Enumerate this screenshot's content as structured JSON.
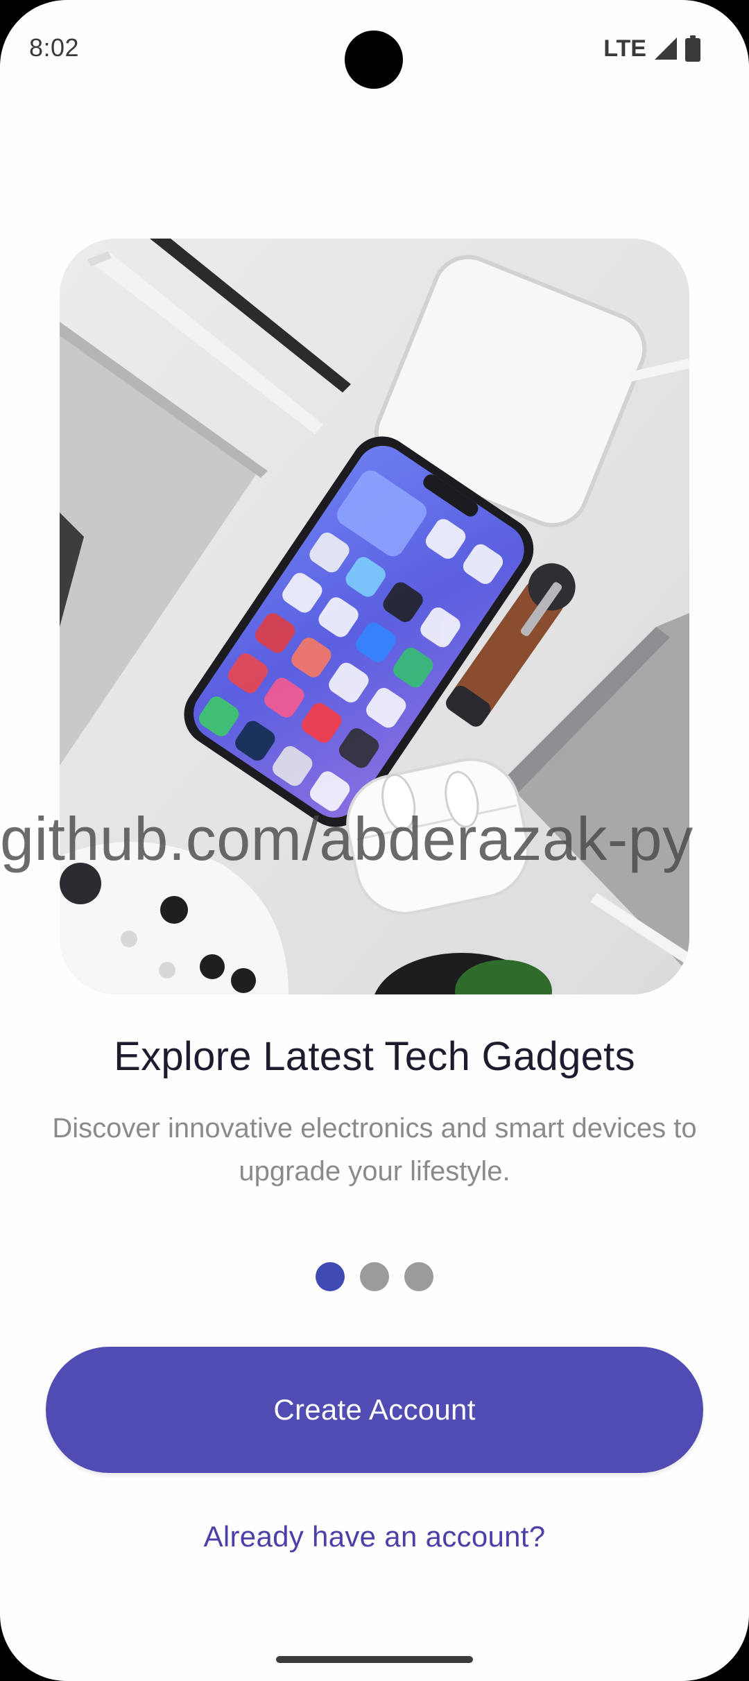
{
  "status_bar": {
    "time": "8:02",
    "network": "LTE",
    "icons": [
      "signal-icon",
      "battery-icon"
    ]
  },
  "hero_image": {
    "icon": "tech-gadgets-photo"
  },
  "watermark": "github.com/abderazak-py",
  "onboarding": {
    "title": "Explore Latest Tech Gadgets",
    "subtitle": "Discover innovative electronics and smart devices to upgrade your lifestyle.",
    "pages_total": 3,
    "current_page": 1
  },
  "actions": {
    "create_account_label": "Create Account",
    "sign_in_link": "Already have an account?"
  },
  "colors": {
    "accent": "#514bb4",
    "active_dot": "#3f4bb3",
    "inactive_dot": "#9b9b9b",
    "title_text": "#1e1b2e",
    "subtitle_text": "#8a8a8c",
    "link_text": "#4a40a8"
  }
}
